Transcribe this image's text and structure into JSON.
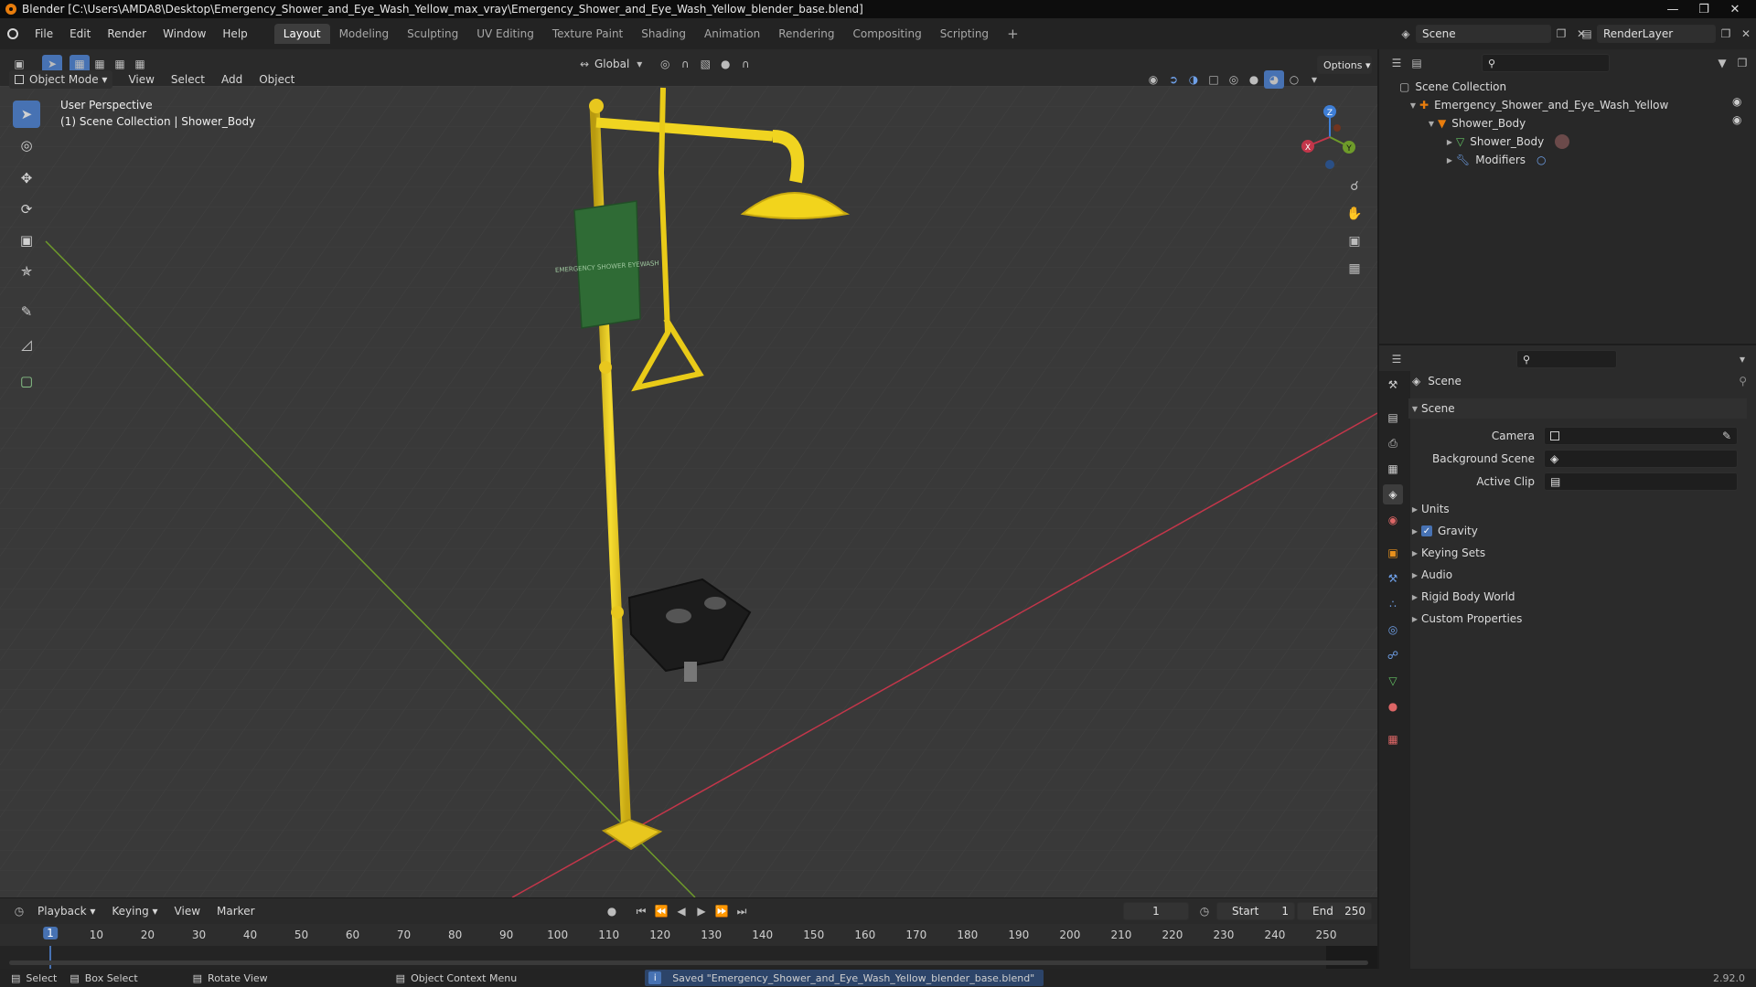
{
  "titlebar": {
    "title": "Blender [C:\\Users\\AMDA8\\Desktop\\Emergency_Shower_and_Eye_Wash_Yellow_max_vray\\Emergency_Shower_and_Eye_Wash_Yellow_blender_base.blend]"
  },
  "menubar": {
    "menus": [
      "File",
      "Edit",
      "Render",
      "Window",
      "Help"
    ],
    "workspaces": [
      "Layout",
      "Modeling",
      "Sculpting",
      "UV Editing",
      "Texture Paint",
      "Shading",
      "Animation",
      "Rendering",
      "Compositing",
      "Scripting"
    ],
    "active_workspace": "Layout",
    "add_workspace": "+",
    "scene": "Scene",
    "view_layer": "RenderLayer"
  },
  "viewport_header": {
    "mode": "Object Mode",
    "menus": [
      "View",
      "Select",
      "Add",
      "Object"
    ],
    "transform_orientation": "Global",
    "options": "Options"
  },
  "viewport": {
    "perspective": "User Perspective",
    "collection_info": "(1) Scene Collection | Shower_Body",
    "sign_text": "EMERGENCY SHOWER EYEWASH",
    "gizmo": {
      "x": "X",
      "y": "Y",
      "z": "Z"
    }
  },
  "outliner": {
    "root": "Scene Collection",
    "items": [
      {
        "label": "Emergency_Shower_and_Eye_Wash_Yellow"
      },
      {
        "label": "Shower_Body"
      },
      {
        "label": "Shower_Body"
      },
      {
        "label": "Modifiers"
      }
    ]
  },
  "properties": {
    "context": "Scene",
    "panel_title": "Scene",
    "fields": [
      {
        "label": "Camera",
        "value": ""
      },
      {
        "label": "Background Scene",
        "value": ""
      },
      {
        "label": "Active Clip",
        "value": ""
      }
    ],
    "sections": [
      "Units",
      "Gravity",
      "Keying Sets",
      "Audio",
      "Rigid Body World",
      "Custom Properties"
    ],
    "gravity_checked": true
  },
  "timeline": {
    "menus": [
      "Playback",
      "Keying",
      "View",
      "Marker"
    ],
    "current_frame": "1",
    "start_label": "Start",
    "start": "1",
    "end_label": "End",
    "end": "250",
    "ticks": [
      "1",
      "10",
      "20",
      "30",
      "40",
      "50",
      "60",
      "70",
      "80",
      "90",
      "100",
      "110",
      "120",
      "130",
      "140",
      "150",
      "160",
      "170",
      "180",
      "190",
      "200",
      "210",
      "220",
      "230",
      "240",
      "250"
    ]
  },
  "statusbar": {
    "select": "Select",
    "box_select": "Box Select",
    "rotate_view": "Rotate View",
    "context_menu": "Object Context Menu",
    "message": "Saved \"Emergency_Shower_and_Eye_Wash_Yellow_blender_base.blend\"",
    "version": "2.92.0"
  },
  "colors": {
    "accent": "#4772b3",
    "x_axis": "#c3364a",
    "y_axis": "#6e9b2a",
    "z_axis": "#3e7ed6",
    "model_yellow": "#f2d41c",
    "sign_green": "#2f6b35"
  }
}
